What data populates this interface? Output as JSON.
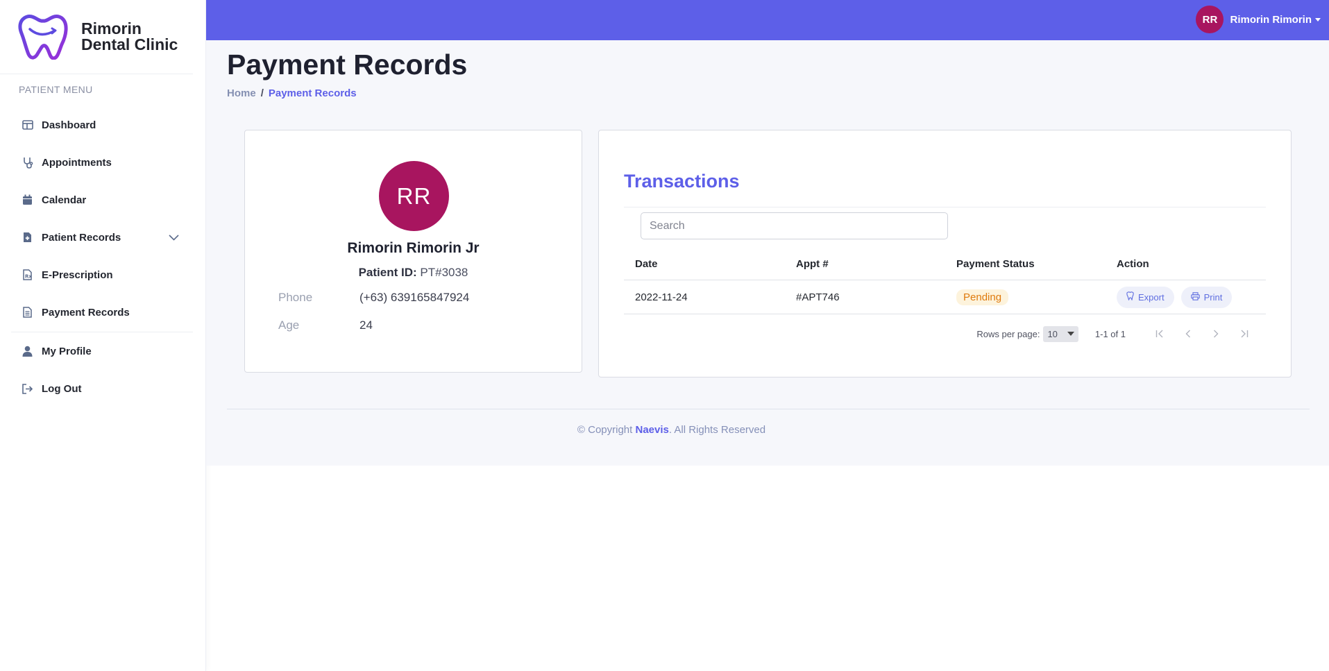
{
  "brand": {
    "line1": "Rimorin",
    "line2": "Dental Clinic"
  },
  "sidebar": {
    "heading": "Patient Menu",
    "items": [
      {
        "label": "Dashboard",
        "icon": "layout-icon"
      },
      {
        "label": "Appointments",
        "icon": "stethoscope-icon"
      },
      {
        "label": "Calendar",
        "icon": "calendar-icon"
      },
      {
        "label": "Patient Records",
        "icon": "file-medical-icon"
      },
      {
        "label": "E-Prescription",
        "icon": "prescription-icon"
      },
      {
        "label": "Payment Records",
        "icon": "document-icon"
      },
      {
        "label": "My Profile",
        "icon": "user-icon"
      },
      {
        "label": "Log Out",
        "icon": "logout-icon"
      }
    ]
  },
  "topbar": {
    "initials": "RR",
    "user_name": "Rimorin Rimorin"
  },
  "page": {
    "title": "Payment Records",
    "breadcrumb": {
      "home": "Home",
      "separator": "/",
      "current": "Payment Records"
    }
  },
  "profile": {
    "initials": "RR",
    "name": "Rimorin Rimorin Jr",
    "id_label": "Patient ID:",
    "id_value": "PT#3038",
    "phone_label": "Phone",
    "phone_value": "(+63) 639165847924",
    "age_label": "Age",
    "age_value": "24"
  },
  "transactions": {
    "title": "Transactions",
    "search_placeholder": "Search",
    "columns": [
      "Date",
      "Appt #",
      "Payment Status",
      "Action"
    ],
    "rows": [
      {
        "date": "2022-11-24",
        "appt": "#APT746",
        "status": "Pending",
        "export_label": "Export",
        "print_label": "Print"
      }
    ],
    "pager": {
      "rows_label": "Rows per page:",
      "rows_value": "10",
      "range": "1-1 of 1"
    }
  },
  "footer": {
    "prefix": "© Copyright ",
    "brand": "Naevis",
    "suffix": ". All Rights Reserved"
  },
  "colors": {
    "accent": "#5d5fe8",
    "avatar": "#a8155f",
    "pending": "#df7a0d"
  }
}
